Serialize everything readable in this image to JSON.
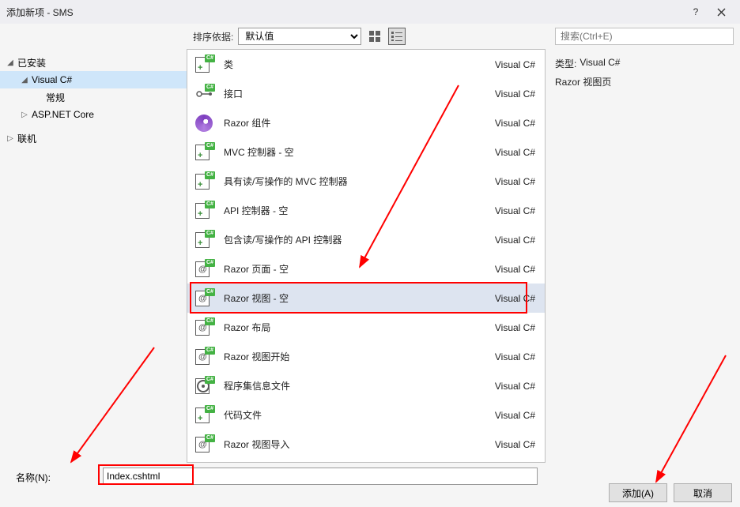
{
  "window": {
    "title": "添加新项 - SMS"
  },
  "toolbar": {
    "sort_label": "排序依据:",
    "sort_value": "默认值",
    "search_placeholder": "搜索(Ctrl+E)"
  },
  "tree": {
    "installed": "已安装",
    "visual_csharp": "Visual C#",
    "general": "常规",
    "aspnet_core": "ASP.NET Core",
    "online": "联机"
  },
  "templates": [
    {
      "name": "类",
      "lang": "Visual C#",
      "icon": "class"
    },
    {
      "name": "接口",
      "lang": "Visual C#",
      "icon": "interface"
    },
    {
      "name": "Razor 组件",
      "lang": "Visual C#",
      "icon": "razor-comp"
    },
    {
      "name": "MVC 控制器 - 空",
      "lang": "Visual C#",
      "icon": "class"
    },
    {
      "name": "具有读/写操作的 MVC 控制器",
      "lang": "Visual C#",
      "icon": "class"
    },
    {
      "name": "API 控制器 - 空",
      "lang": "Visual C#",
      "icon": "class"
    },
    {
      "name": "包含读/写操作的 API 控制器",
      "lang": "Visual C#",
      "icon": "class"
    },
    {
      "name": "Razor 页面 - 空",
      "lang": "Visual C#",
      "icon": "at"
    },
    {
      "name": "Razor 视图 - 空",
      "lang": "Visual C#",
      "icon": "at",
      "selected": true
    },
    {
      "name": "Razor 布局",
      "lang": "Visual C#",
      "icon": "at"
    },
    {
      "name": "Razor 视图开始",
      "lang": "Visual C#",
      "icon": "at"
    },
    {
      "name": "程序集信息文件",
      "lang": "Visual C#",
      "icon": "assembly"
    },
    {
      "name": "代码文件",
      "lang": "Visual C#",
      "icon": "class"
    },
    {
      "name": "Razor 视图导入",
      "lang": "Visual C#",
      "icon": "at"
    }
  ],
  "details": {
    "type_label": "类型:",
    "type_value": "Visual C#",
    "description": "Razor 视图页"
  },
  "bottom": {
    "name_label": "名称(N):",
    "filename": "Index.cshtml",
    "add": "添加(A)",
    "cancel": "取消"
  }
}
